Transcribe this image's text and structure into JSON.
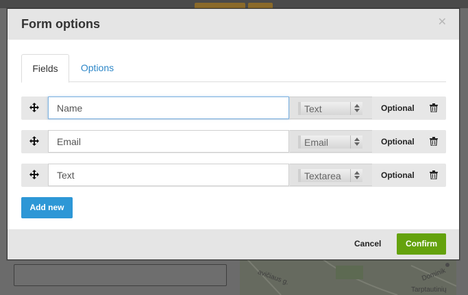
{
  "modal": {
    "title": "Form options",
    "close_icon": "close-icon",
    "tabs": [
      {
        "label": "Fields",
        "active": true
      },
      {
        "label": "Options",
        "active": false
      }
    ],
    "fields": [
      {
        "name": "Name",
        "type": "Text",
        "optional_label": "Optional",
        "focused": true
      },
      {
        "name": "Email",
        "type": "Email",
        "optional_label": "Optional",
        "focused": false
      },
      {
        "name": "Text",
        "type": "Textarea",
        "optional_label": "Optional",
        "focused": false
      }
    ],
    "add_new_label": "Add new",
    "footer": {
      "cancel_label": "Cancel",
      "confirm_label": "Confirm"
    }
  },
  "background": {
    "map_labels": [
      "avičiaus g.",
      "Tarptautinių",
      "Dominik"
    ]
  },
  "colors": {
    "accent_blue": "#2d97d6",
    "confirm_green": "#64a20d",
    "tab_link": "#2d87c8"
  }
}
